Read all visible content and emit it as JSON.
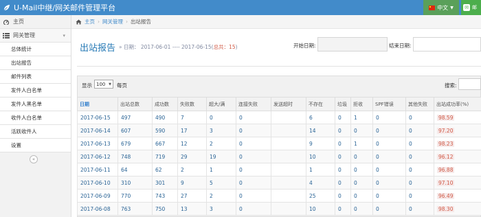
{
  "header": {
    "brand": "U-Mail中继/网关邮件管理平台",
    "lang_label": "中文",
    "user_label": "邮"
  },
  "sidebar": {
    "home": "主页",
    "group": "网关管理",
    "items": [
      "总体统计",
      "出站报告",
      "邮件列表",
      "发件人白名单",
      "发件人黑名单",
      "收件人白名单",
      "活跃收件人",
      "设置"
    ]
  },
  "breadcrumb": [
    "主页",
    "网关管理",
    "出站报告"
  ],
  "page": {
    "title": "出站报告",
    "subtitle_prefix": "» 日期：  2017-06-01 ---- 2017-06-15(",
    "subtitle_total": "总共：15",
    "subtitle_suffix": ")",
    "start_label": "开始日期:",
    "end_label": "结束日期:"
  },
  "table_controls": {
    "show_label": "显示",
    "page_size": "100",
    "rows_label": "每页",
    "search_label": "搜索:"
  },
  "table": {
    "headers": [
      "日期",
      "出站总数",
      "成功数",
      "失败数",
      "超大/满",
      "连接失败",
      "发送超时",
      "不存在",
      "垃圾",
      "拒收",
      "SPF错误",
      "其他失败",
      "出站成功率(%)"
    ],
    "rows": [
      [
        "2017-06-15",
        "497",
        "490",
        "7",
        "0",
        "0",
        "",
        "6",
        "0",
        "1",
        "0",
        "0",
        "98.59"
      ],
      [
        "2017-06-14",
        "607",
        "590",
        "17",
        "3",
        "0",
        "",
        "14",
        "0",
        "0",
        "0",
        "0",
        "97.20"
      ],
      [
        "2017-06-13",
        "679",
        "667",
        "12",
        "2",
        "0",
        "",
        "9",
        "0",
        "1",
        "0",
        "0",
        "98.23"
      ],
      [
        "2017-06-12",
        "748",
        "719",
        "29",
        "19",
        "0",
        "",
        "10",
        "0",
        "0",
        "0",
        "0",
        "96.12"
      ],
      [
        "2017-06-11",
        "64",
        "62",
        "2",
        "1",
        "0",
        "",
        "1",
        "0",
        "0",
        "0",
        "0",
        "96.88"
      ],
      [
        "2017-06-10",
        "310",
        "301",
        "9",
        "5",
        "0",
        "",
        "4",
        "0",
        "0",
        "0",
        "0",
        "97.10"
      ],
      [
        "2017-06-09",
        "770",
        "743",
        "27",
        "2",
        "0",
        "",
        "25",
        "0",
        "0",
        "0",
        "0",
        "96.49"
      ],
      [
        "2017-06-08",
        "763",
        "750",
        "13",
        "3",
        "0",
        "",
        "10",
        "0",
        "0",
        "0",
        "0",
        "98.30"
      ]
    ]
  },
  "colors": {
    "topbar": "#428bca",
    "link": "#2a6496",
    "rate": "#d15b47"
  }
}
